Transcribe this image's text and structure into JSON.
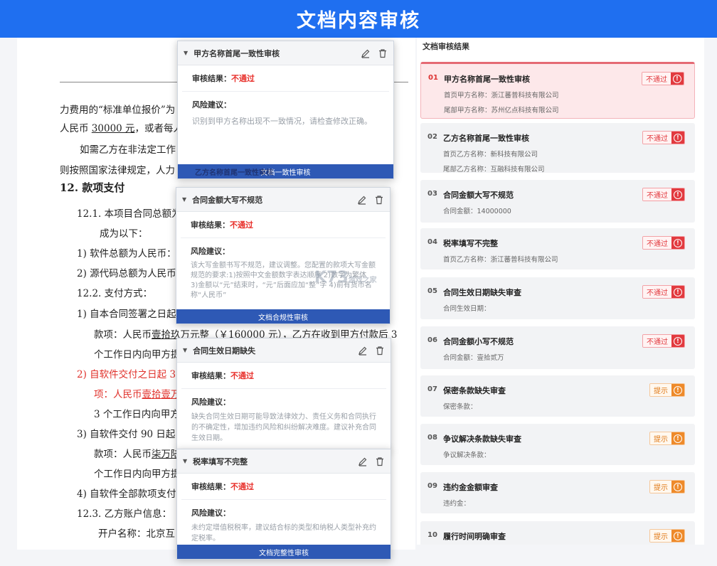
{
  "banner": {
    "title": "文档内容审核"
  },
  "document": {
    "lines": [
      "力费用的“标准单位报价”为",
      "人民币",
      "30000 元",
      "，或者每人每",
      "如需乙方在非法定工作日",
      "则按照国家法律规定，人力",
      "12. 款项支付",
      "12.1. 本项目合同总额为",
      "成为以下：",
      "1) 软件总额为人民币：",
      "2) 源代码总额为人民币：",
      "12.2. 支付方式：",
      "1) 自本合同签署之日起",
      "款项：人民币",
      "壹拾玖万元整（￥160000 元）",
      "，乙方在收到甲方付款后 3",
      "个工作日内向甲方提",
      "2) 自软件交付之日起 3",
      "项：人民币",
      "壹拾壹万",
      "3 个工作日内向甲方",
      "3) 自软件交付 90 日起 3",
      "款项：人民币",
      "柒万陆",
      "个工作日内向甲方提",
      "4) 自软件全部款项支付",
      "12.3. 乙方账户信息：",
      "开户名称：北京互"
    ]
  },
  "popups": [
    {
      "title": "甲方名称首尾一致性审核",
      "result_label": "审核结果：",
      "result_value": "不通过",
      "risk_label": "风险建议：",
      "risk_text": "识别到甲方名称出现不一致情况，请检查修改正确。",
      "ghost_title": "乙方名称首尾一致性审核",
      "footer": "文档一致性审核"
    },
    {
      "title": "合同金额大写不规范",
      "result_label": "审核结果：",
      "result_value": "不通过",
      "risk_label": "风险建议：",
      "risk_text": "该大写金额书写不规范，建议调整。您配置的款项大写金额规范的要求:1)按照中文金额数字表达顺序 2)数字为繁体 3)金额以“元”结束时，“元”后面应加“整”字 4)前有货币名称“人民币”",
      "footer": "文档合规性审核"
    },
    {
      "title": "合同生效日期缺失",
      "result_label": "审核结果：",
      "result_value": "不通过",
      "risk_label": "风险建议：",
      "risk_text": "缺失合同生效日期可能导致法律效力、责任义务和合同执行的不确定性，增加违约风险和纠纷解决难度。建议补充合同生效日期。"
    },
    {
      "title": "税率填写不完整",
      "result_label": "审核结果：",
      "result_value": "不通过",
      "risk_label": "风险建议：",
      "risk_text": "未约定增值税税率，建议结合标的类型和纳税人类型补充约定税率。",
      "footer": "文档完整性审核"
    }
  ],
  "results": {
    "title": "文档审核结果",
    "items": [
      {
        "num": "01",
        "name": "甲方名称首尾一致性审核",
        "tag": "不通过",
        "details": [
          "首页甲方名称：浙江蕃普科技有限公司",
          "尾部甲方名称：苏州亿点科技有限公司"
        ]
      },
      {
        "num": "02",
        "name": "乙方名称首尾一致性审核",
        "tag": "不通过",
        "details": [
          "首页乙方名称：新科技有限公司",
          "尾部乙方名称：互融科技有限公司"
        ]
      },
      {
        "num": "03",
        "name": "合同金额大写不规范",
        "tag": "不通过",
        "details": [
          "合同金额：14000000"
        ]
      },
      {
        "num": "04",
        "name": "税率填写不完整",
        "tag": "不通过",
        "details": [
          "首页乙方名称：浙江蕃普科技有限公司"
        ]
      },
      {
        "num": "05",
        "name": "合同生效日期缺失审查",
        "tag": "不通过",
        "details": [
          "合同生效日期："
        ]
      },
      {
        "num": "06",
        "name": "合同金额小写不规范",
        "tag": "不通过",
        "details": [
          "合同金额：壹拾贰万"
        ]
      },
      {
        "num": "07",
        "name": "保密条款缺失审查",
        "tag": "提示",
        "details": [
          "保密条款："
        ]
      },
      {
        "num": "08",
        "name": "争议解决条款缺失审查",
        "tag": "提示",
        "details": [
          "争议解决条款："
        ]
      },
      {
        "num": "09",
        "name": "违约金金额审查",
        "tag": "提示",
        "details": [
          "违约金："
        ]
      },
      {
        "num": "10",
        "name": "履行时间明确审查",
        "tag": "提示",
        "details": []
      }
    ]
  },
  "watermark": {
    "text": "K73",
    "sub": "游戏之家"
  }
}
